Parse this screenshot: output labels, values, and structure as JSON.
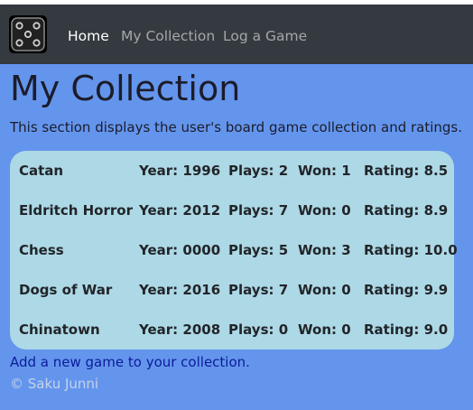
{
  "nav": {
    "brand_icon": "dice-five-icon",
    "items": [
      {
        "label": "Home",
        "active": true
      },
      {
        "label": "My Collection",
        "active": false
      },
      {
        "label": "Log a Game",
        "active": false
      }
    ]
  },
  "main": {
    "title": "My Collection",
    "description": "This section displays the user's board game collection and ratings.",
    "games": [
      {
        "name": "Catan",
        "year": "Year: 1996",
        "plays": "Plays: 2",
        "won": "Won: 1",
        "rating": "Rating: 8.5"
      },
      {
        "name": "Eldritch Horror",
        "year": "Year: 2012",
        "plays": "Plays: 7",
        "won": "Won: 0",
        "rating": "Rating: 8.9"
      },
      {
        "name": "Chess",
        "year": "Year: 0000",
        "plays": "Plays: 5",
        "won": "Won: 3",
        "rating": "Rating: 10.0"
      },
      {
        "name": "Dogs of War",
        "year": "Year: 2016",
        "plays": "Plays: 7",
        "won": "Won: 0",
        "rating": "Rating: 9.9"
      },
      {
        "name": "Chinatown",
        "year": "Year: 2008",
        "plays": "Plays: 0",
        "won": "Won: 0",
        "rating": "Rating: 9.0"
      }
    ],
    "add_link": "Add a new game to your collection.",
    "footer": "© Saku Junni"
  },
  "colors": {
    "navbar": "#343a40",
    "page_background": "#6495ed",
    "collection_background": "#add8e6",
    "link": "#0b1c9a"
  }
}
